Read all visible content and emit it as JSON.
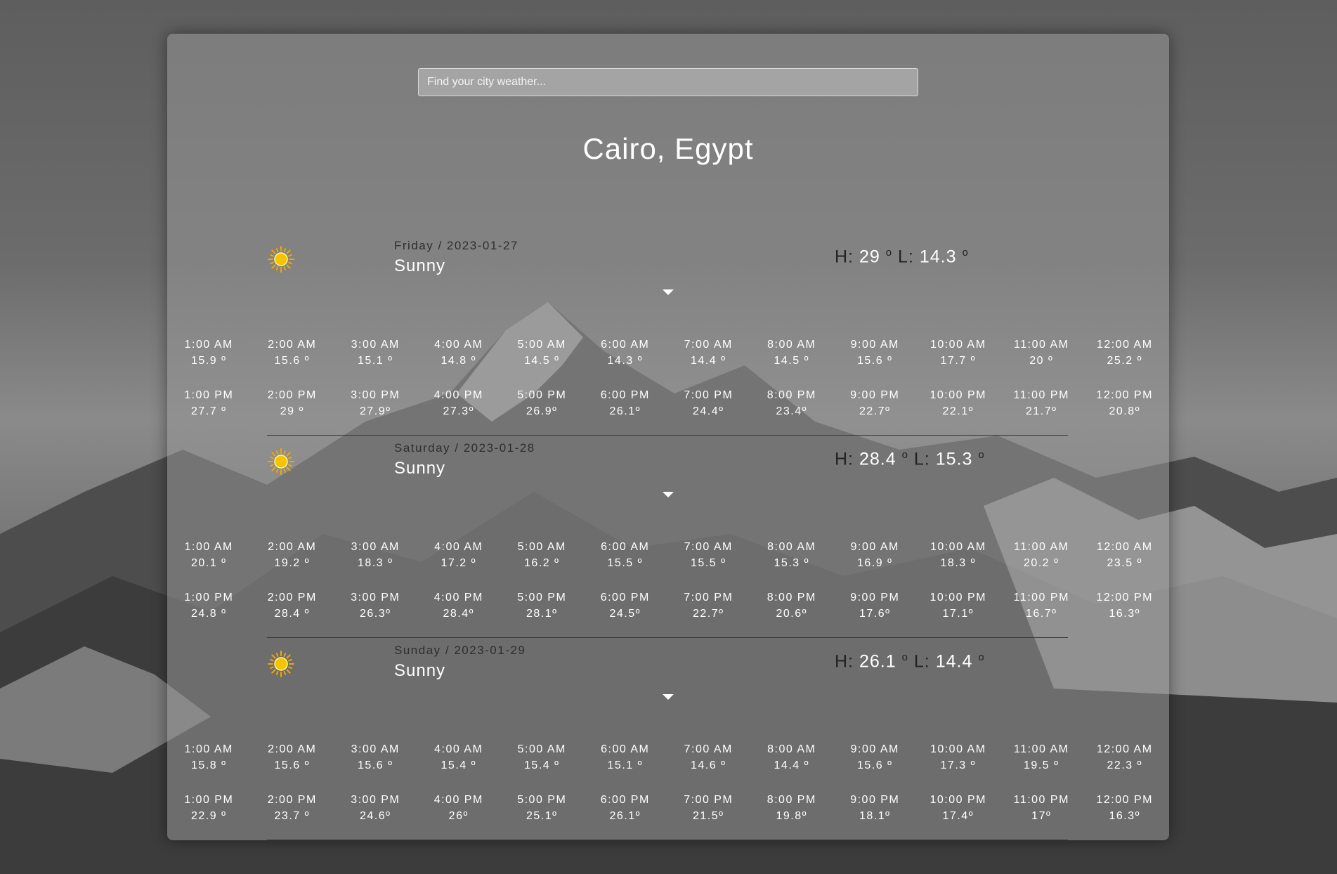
{
  "search": {
    "placeholder": "Find your city weather..."
  },
  "location": {
    "title": "Cairo, Egypt"
  },
  "days": [
    {
      "date": "Friday / 2023-01-27",
      "condition": "Sunny",
      "high": "29",
      "low": "14.3",
      "icon": "sun-icon",
      "am": [
        {
          "time": "1:00 AM",
          "temp": "15.9 º"
        },
        {
          "time": "2:00 AM",
          "temp": "15.6 º"
        },
        {
          "time": "3:00 AM",
          "temp": "15.1 º"
        },
        {
          "time": "4:00 AM",
          "temp": "14.8 º"
        },
        {
          "time": "5:00 AM",
          "temp": "14.5 º"
        },
        {
          "time": "6:00 AM",
          "temp": "14.3 º"
        },
        {
          "time": "7:00 AM",
          "temp": "14.4 º"
        },
        {
          "time": "8:00 AM",
          "temp": "14.5 º"
        },
        {
          "time": "9:00 AM",
          "temp": "15.6 º"
        },
        {
          "time": "10:00 AM",
          "temp": "17.7 º"
        },
        {
          "time": "11:00 AM",
          "temp": "20 º"
        },
        {
          "time": "12:00 AM",
          "temp": "25.2 º"
        }
      ],
      "pm": [
        {
          "time": "1:00 PM",
          "temp": "27.7 º"
        },
        {
          "time": "2:00 PM",
          "temp": "29 º"
        },
        {
          "time": "3:00 PM",
          "temp": "27.9º"
        },
        {
          "time": "4:00 PM",
          "temp": "27.3º"
        },
        {
          "time": "5:00 PM",
          "temp": "26.9º"
        },
        {
          "time": "6:00 PM",
          "temp": "26.1º"
        },
        {
          "time": "7:00 PM",
          "temp": "24.4º"
        },
        {
          "time": "8:00 PM",
          "temp": "23.4º"
        },
        {
          "time": "9:00 PM",
          "temp": "22.7º"
        },
        {
          "time": "10:00 PM",
          "temp": "22.1º"
        },
        {
          "time": "11:00 PM",
          "temp": "21.7º"
        },
        {
          "time": "12:00 PM",
          "temp": "20.8º"
        }
      ]
    },
    {
      "date": "Saturday / 2023-01-28",
      "condition": "Sunny",
      "high": "28.4",
      "low": "15.3",
      "icon": "sun-icon",
      "am": [
        {
          "time": "1:00 AM",
          "temp": "20.1 º"
        },
        {
          "time": "2:00 AM",
          "temp": "19.2 º"
        },
        {
          "time": "3:00 AM",
          "temp": "18.3 º"
        },
        {
          "time": "4:00 AM",
          "temp": "17.2 º"
        },
        {
          "time": "5:00 AM",
          "temp": "16.2 º"
        },
        {
          "time": "6:00 AM",
          "temp": "15.5 º"
        },
        {
          "time": "7:00 AM",
          "temp": "15.5 º"
        },
        {
          "time": "8:00 AM",
          "temp": "15.3 º"
        },
        {
          "time": "9:00 AM",
          "temp": "16.9 º"
        },
        {
          "time": "10:00 AM",
          "temp": "18.3 º"
        },
        {
          "time": "11:00 AM",
          "temp": "20.2 º"
        },
        {
          "time": "12:00 AM",
          "temp": "23.5 º"
        }
      ],
      "pm": [
        {
          "time": "1:00 PM",
          "temp": "24.8 º"
        },
        {
          "time": "2:00 PM",
          "temp": "28.4 º"
        },
        {
          "time": "3:00 PM",
          "temp": "26.3º"
        },
        {
          "time": "4:00 PM",
          "temp": "28.4º"
        },
        {
          "time": "5:00 PM",
          "temp": "28.1º"
        },
        {
          "time": "6:00 PM",
          "temp": "24.5º"
        },
        {
          "time": "7:00 PM",
          "temp": "22.7º"
        },
        {
          "time": "8:00 PM",
          "temp": "20.6º"
        },
        {
          "time": "9:00 PM",
          "temp": "17.6º"
        },
        {
          "time": "10:00 PM",
          "temp": "17.1º"
        },
        {
          "time": "11:00 PM",
          "temp": "16.7º"
        },
        {
          "time": "12:00 PM",
          "temp": "16.3º"
        }
      ]
    },
    {
      "date": "Sunday / 2023-01-29",
      "condition": "Sunny",
      "high": "26.1",
      "low": "14.4",
      "icon": "sun-icon",
      "am": [
        {
          "time": "1:00 AM",
          "temp": "15.8 º"
        },
        {
          "time": "2:00 AM",
          "temp": "15.6 º"
        },
        {
          "time": "3:00 AM",
          "temp": "15.6 º"
        },
        {
          "time": "4:00 AM",
          "temp": "15.4 º"
        },
        {
          "time": "5:00 AM",
          "temp": "15.4 º"
        },
        {
          "time": "6:00 AM",
          "temp": "15.1 º"
        },
        {
          "time": "7:00 AM",
          "temp": "14.6 º"
        },
        {
          "time": "8:00 AM",
          "temp": "14.4 º"
        },
        {
          "time": "9:00 AM",
          "temp": "15.6 º"
        },
        {
          "time": "10:00 AM",
          "temp": "17.3 º"
        },
        {
          "time": "11:00 AM",
          "temp": "19.5 º"
        },
        {
          "time": "12:00 AM",
          "temp": "22.3 º"
        }
      ],
      "pm": [
        {
          "time": "1:00 PM",
          "temp": "22.9 º"
        },
        {
          "time": "2:00 PM",
          "temp": "23.7 º"
        },
        {
          "time": "3:00 PM",
          "temp": "24.6º"
        },
        {
          "time": "4:00 PM",
          "temp": "26º"
        },
        {
          "time": "5:00 PM",
          "temp": "25.1º"
        },
        {
          "time": "6:00 PM",
          "temp": "26.1º"
        },
        {
          "time": "7:00 PM",
          "temp": "21.5º"
        },
        {
          "time": "8:00 PM",
          "temp": "19.8º"
        },
        {
          "time": "9:00 PM",
          "temp": "18.1º"
        },
        {
          "time": "10:00 PM",
          "temp": "17.4º"
        },
        {
          "time": "11:00 PM",
          "temp": "17º"
        },
        {
          "time": "12:00 PM",
          "temp": "16.3º"
        }
      ]
    }
  ],
  "labels": {
    "high_prefix": "H:",
    "low_prefix": "L:",
    "degree": "o"
  },
  "colors": {
    "sun": "#f5c400",
    "sun_ray": "#f0a800",
    "card": "#969696"
  }
}
